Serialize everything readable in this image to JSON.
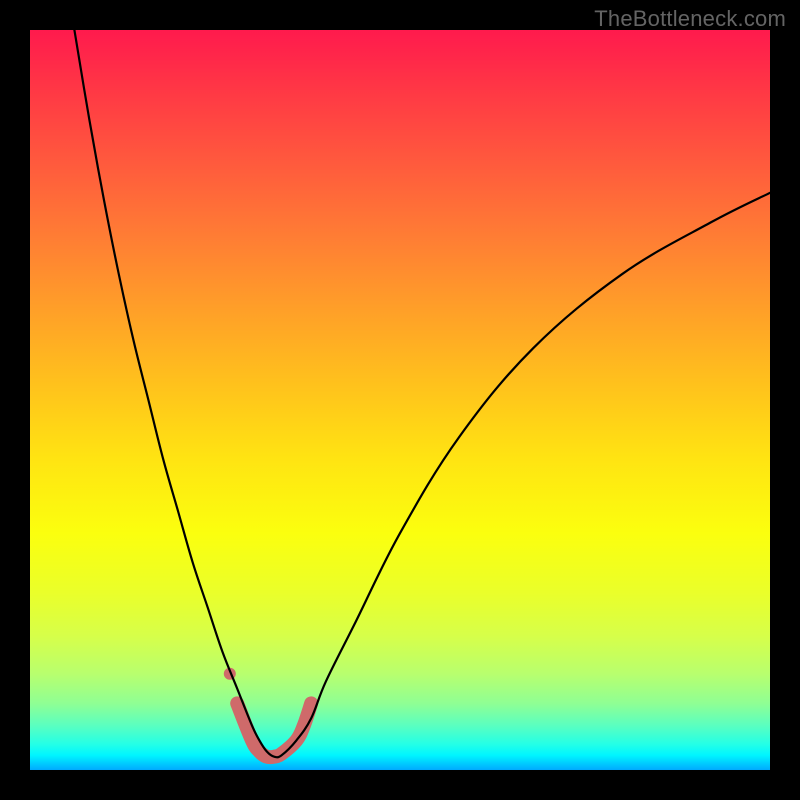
{
  "attribution": "TheBottleneck.com",
  "chart_data": {
    "type": "line",
    "title": "",
    "xlabel": "",
    "ylabel": "",
    "xlim": [
      0,
      100
    ],
    "ylim": [
      0,
      100
    ],
    "legend": false,
    "grid": false,
    "background": {
      "gradient_axis": "y",
      "stops": [
        {
          "pos": 0,
          "color": "#ff1a4d"
        },
        {
          "pos": 50,
          "color": "#ffe412"
        },
        {
          "pos": 98,
          "color": "#00f6ff"
        }
      ]
    },
    "series": [
      {
        "name": "bottleneck-curve",
        "color": "#000000",
        "x": [
          6,
          8,
          10,
          12,
          14,
          16,
          18,
          20,
          22,
          24,
          26,
          28,
          30,
          31,
          32,
          33,
          34,
          36,
          38,
          40,
          44,
          50,
          58,
          68,
          80,
          92,
          100
        ],
        "y": [
          100,
          88,
          77,
          67,
          58,
          50,
          42,
          35,
          28,
          22,
          16,
          11,
          6,
          4,
          2.5,
          1.8,
          2,
          4,
          7,
          12,
          20,
          32,
          45,
          57,
          67,
          74,
          78
        ]
      }
    ],
    "annotations": [
      {
        "name": "optimal-range-highlight",
        "type": "path",
        "color": "#cf6a6a",
        "stroke_width": 14,
        "x": [
          28,
          30,
          31,
          32,
          33,
          34,
          36,
          37,
          38
        ],
        "y": [
          9,
          4,
          2.5,
          1.8,
          1.8,
          2.2,
          4,
          6,
          9
        ]
      },
      {
        "name": "optimal-dot",
        "type": "point",
        "color": "#cf6a6a",
        "x": 27,
        "y": 13,
        "radius": 6
      }
    ]
  }
}
